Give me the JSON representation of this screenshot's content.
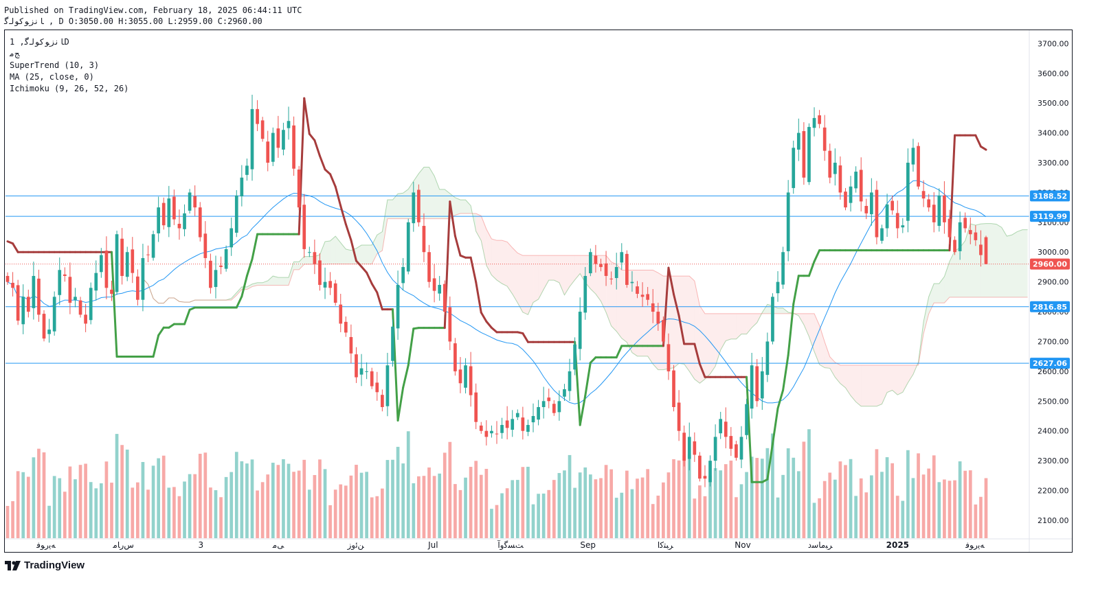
{
  "header": {
    "published": "Published on TradingView.com, February 18, 2025 06:44:11 UTC",
    "ohlc": "ﺎﻧﺯﻮﮐﻮﻟﮔ , D O:3050.00 H:3055.00 L:2959.00 C:2960.00"
  },
  "legend": {
    "symbol": "ﺎﻧﺯﻮﮐﻮﻟﮔ, 1D",
    "exchange": "ﺞﻣ",
    "supertrend": "SuperTrend (10, 3)",
    "ma": "MA (25, close, 0)",
    "ichimoku": "Ichimoku (9, 26, 52, 26)"
  },
  "branding": {
    "logo_text": "TradingView"
  },
  "colors": {
    "up": "#26a69a",
    "down": "#ef5350",
    "st_up": "#43a047",
    "st_down": "#a63c3c",
    "ma": "#2196f3",
    "hline": "#2196f3",
    "cloud_up": "#43a047",
    "cloud_down": "#ef5350"
  },
  "chart_data": {
    "type": "candlestick",
    "symbol": "ﺎﻧﺯﻮﮐﻮﻟﮔ",
    "timeframe": "1D",
    "last": {
      "open": 3050,
      "high": 3055,
      "low": 2959,
      "close": 2960
    },
    "y_axis": {
      "range": [
        2040,
        3740
      ],
      "ticks": [
        2100,
        2200,
        2300,
        2400,
        2500,
        2600,
        2700,
        2800,
        2900,
        3000,
        3100,
        3200,
        3300,
        3400,
        3500,
        3600,
        3700
      ],
      "position": "right"
    },
    "x_axis_labels": [
      "ﻪﯾﺭﻮﻓ",
      "ﺱﺭﺎﻣ",
      "3",
      "ﯽﻣ",
      "ﻦﺋﻭﺯ",
      "Jul",
      "ﺖﺴﮔﻭﺁ",
      "Sep",
      "ﺮﺒﺘﮐﺍ",
      "Nov",
      "ﺮﺒﻣﺎﺳﺩ",
      "2025",
      "ﻪﯾﺭﻮﻓ"
    ],
    "price_lines": [
      {
        "value": 3188.52,
        "label": "3188.52"
      },
      {
        "value": 3119.99,
        "label": "3119.99"
      },
      {
        "value": 2816.85,
        "label": "2816.85"
      },
      {
        "value": 2627.06,
        "label": "2627.06"
      }
    ],
    "last_price_label": "2960.00",
    "grid": false,
    "closes": [
      2900,
      2880,
      2770,
      2850,
      2800,
      2920,
      2790,
      2710,
      2740,
      2850,
      2940,
      2920,
      2830,
      2850,
      2790,
      2760,
      2880,
      2930,
      2990,
      2880,
      2860,
      3060,
      2920,
      3000,
      2930,
      2840,
      2980,
      2990,
      3060,
      3150,
      3090,
      3180,
      3110,
      3080,
      3130,
      3200,
      3150,
      3050,
      2980,
      2880,
      2940,
      2950,
      3010,
      3080,
      3190,
      3250,
      3290,
      3480,
      3430,
      3380,
      3300,
      3400,
      3350,
      3410,
      3440,
      3280,
      3150,
      3010,
      3000,
      2960,
      2890,
      2900,
      2880,
      2830,
      2760,
      2730,
      2660,
      2580,
      2610,
      2600,
      2550,
      2530,
      2480,
      2620,
      2750,
      2890,
      2950,
      3100,
      3200,
      3100,
      3000,
      2900,
      2870,
      2890,
      2800,
      2700,
      2600,
      2560,
      2620,
      2520,
      2430,
      2400,
      2380,
      2400,
      2390,
      2420,
      2410,
      2440,
      2460,
      2400,
      2420,
      2450,
      2480,
      2500,
      2500,
      2460,
      2500,
      2540,
      2600,
      2690,
      2800,
      2920,
      3000,
      2960,
      2950,
      2920,
      2910,
      2950,
      3000,
      2890,
      2900,
      2860,
      2850,
      2840,
      2800,
      2760,
      2700,
      2600,
      2480,
      2400,
      2300,
      2380,
      2320,
      2240,
      2240,
      2300,
      2380,
      2440,
      2380,
      2340,
      2310,
      2380,
      2490,
      2620,
      2500,
      2600,
      2700,
      2850,
      2900,
      3000,
      3200,
      3350,
      3400,
      3250,
      3420,
      3450,
      3430,
      3340,
      3250,
      3300,
      3200,
      3150,
      3220,
      3270,
      3170,
      3130,
      3200,
      3050,
      3080,
      3160,
      3140,
      3080,
      3090,
      3300,
      3350,
      3220,
      3180,
      3150,
      3100,
      3190,
      3100,
      3050,
      3000,
      3100,
      3080,
      3060,
      3040,
      2990,
      2960
    ],
    "series": [
      {
        "name": "SuperTrend (10, 3)",
        "description": "trailing stop line, green below price in uptrend, red above price in downtrend"
      },
      {
        "name": "MA (25, close, 0)",
        "description": "25-period moving average of close"
      },
      {
        "name": "Ichimoku (9, 26, 52, 26)",
        "description": "cloud shaded green when leading span A above span B, red otherwise"
      }
    ]
  }
}
